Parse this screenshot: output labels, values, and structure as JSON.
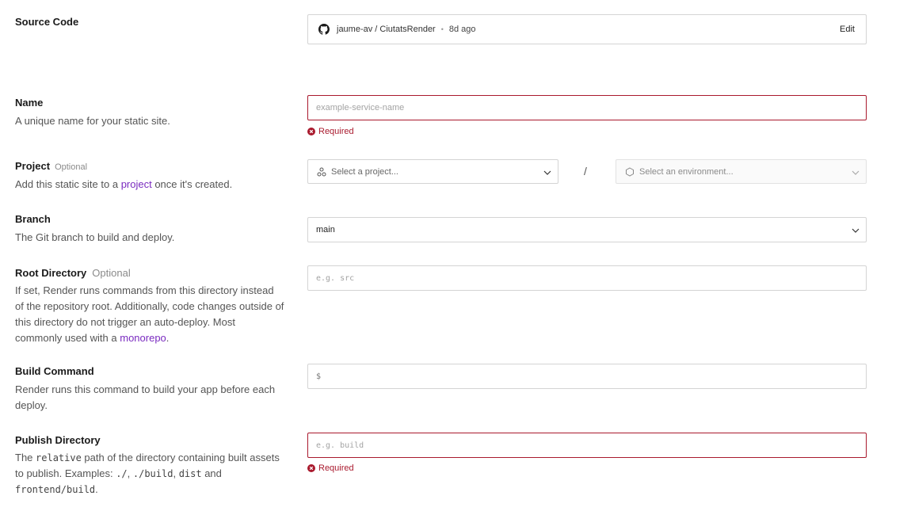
{
  "source_code": {
    "label": "Source Code",
    "repo": "jaume-av / CiutatsRender",
    "separator": "•",
    "age": "8d ago",
    "edit": "Edit"
  },
  "name": {
    "label": "Name",
    "desc": "A unique name for your static site.",
    "placeholder": "example-service-name",
    "error": "Required"
  },
  "project": {
    "label": "Project",
    "optional": "Optional",
    "desc_prefix": "Add this static site to a ",
    "desc_link": "project",
    "desc_suffix": " once it's created.",
    "project_placeholder": "Select a project...",
    "slash": "/",
    "env_placeholder": "Select an environment..."
  },
  "branch": {
    "label": "Branch",
    "desc": "The Git branch to build and deploy.",
    "value": "main"
  },
  "root_directory": {
    "label": "Root Directory",
    "optional": "Optional",
    "desc_prefix": "If set, Render runs commands from this directory instead of the repository root. Additionally, code changes outside of this directory do not trigger an auto-deploy. Most commonly used with a ",
    "desc_link": "monorepo",
    "desc_suffix": ".",
    "placeholder": "e.g. src"
  },
  "build_command": {
    "label": "Build Command",
    "desc": "Render runs this command to build your app before each deploy.",
    "prefix": "$"
  },
  "publish_directory": {
    "label": "Publish Directory",
    "desc_1": "The ",
    "code_1": "relative",
    "desc_2": " path of the directory containing built assets to publish. Examples: ",
    "code_2": "./",
    "desc_3": ", ",
    "code_3": "./build",
    "desc_4": ", ",
    "code_4": "dist",
    "desc_5": " and ",
    "code_5": "frontend/build",
    "desc_6": ".",
    "placeholder": "e.g. build",
    "error": "Required"
  },
  "colors": {
    "error": "#a9192d",
    "link": "#7b2cc0",
    "border": "#d4d4d4"
  }
}
